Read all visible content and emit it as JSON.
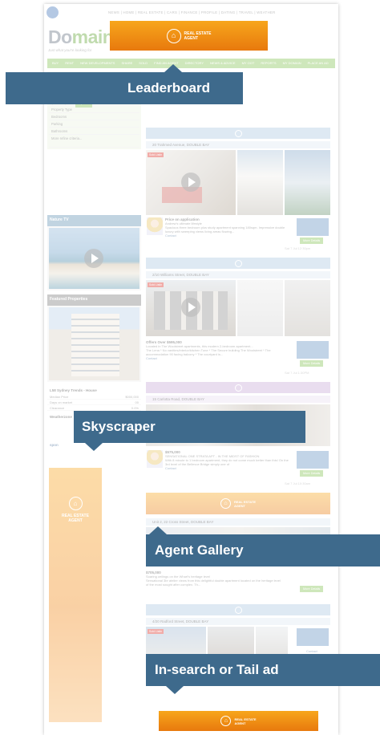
{
  "site": {
    "logo_text_a": "Do",
    "logo_text_b": "main",
    "tagline": "Just what you're looking for",
    "top_links": "NEWS | HOME | REAL ESTATE | CARS | FINANCE | PROFILE | DATING | TRAVEL | WEATHER",
    "nav": [
      "BUY",
      "RENT",
      "NEW DEVELOPMENTS",
      "SHARE",
      "SOLD",
      "FIND AN AGENT",
      "DIRECTORY",
      "NEWS & ADVICE",
      "MY OOT",
      "REPORTS",
      "MY DOMAIN",
      "PLACE AN AD"
    ]
  },
  "ads": {
    "brand_line1": "REAL ESTATE",
    "brand_line2": "AGENT"
  },
  "sidebar": {
    "rows": [
      "New developments",
      "Surrounding Suburbs",
      "Price",
      "$ Min   to $ Max",
      "Property Type",
      "Bedrooms",
      "Parking",
      "Bathrooms",
      "More refine criteria..."
    ],
    "update_btn": "Update",
    "widget1_title": "Nature TV",
    "widget2_title": "Featured Properties",
    "stats_title": "L58 Sydney Trends - House",
    "stats_rows": [
      {
        "k": "Median Price",
        "v": "$000,000"
      },
      {
        "k": "Days on market",
        "v": "00"
      },
      {
        "k": "Clearance",
        "v": "0.0%"
      }
    ],
    "weather_label": "Weatherzone",
    "spon_label": "spon"
  },
  "listings": [
    {
      "title": "20 Trahmed Avenue, DOUBLE BAY",
      "tag": "Sold Listin",
      "desc_title": "Price on application",
      "desc_sub": "Andrew's ultimate lifestyle",
      "desc_text": "Spacious three bedroom plus study apartment spanning 180sqm. Impressive double luxury with sweeping views living areas flowing...",
      "contact": "Contact",
      "more": "More Details",
      "inspect": "Sat 7 Jul 12:30pm"
    },
    {
      "title": "2/10 Williams Street, DOUBLE BAY",
      "tag": "Sold Listin",
      "desc_title": "Offers Over $595,000",
      "desc_sub": "Located in The Woolstreet apartments, this modern 2-bedroom apartment...",
      "desc_text": "The Lena * No vanities/interior/kitchen Tune * The Secure building The Woolstreet * The accommodation 90 facing balcony * The courtyard is...",
      "contact": "Contact",
      "more": "More Details",
      "inspect": "Sat 7 Jul 1:30PM"
    },
    {
      "title": "15 Carlotta Road, DOUBLE BAY",
      "tag": "",
      "desc_title": "$575,000",
      "desc_sub": "SENSATIONAL ONE STRATA APT - IN THE MIDST OF FASHION",
      "desc_text": "With 8 minute to 1 bedroom apartment, they do not come much better than this! On the 3rd level of the Bellevue Bridge simply one of",
      "contact": "Contact",
      "more": "More Details",
      "inspect": "Sat 7 Jul 10:30am"
    },
    {
      "title": "Unit 2, 22 Cross Street, DOUBLE BAY",
      "tag": "",
      "desc_title": "$705,000",
      "desc_sub": "Soaring ceilings on the Wharf's heritage level",
      "desc_text": "Sensational 3br atelier views from this delightful double apartment located on the heritage level of the most sought after complex. Th...",
      "contact": "",
      "more": "More Details",
      "inspect": ""
    },
    {
      "title": "4/20 Radford Street, DOUBLE BAY",
      "tag": "Sold Listin",
      "desc_title": "",
      "desc_sub": "",
      "desc_text": "",
      "contact": "Contact",
      "more": "More Details",
      "inspect": ""
    }
  ],
  "callouts": {
    "leaderboard": "Leaderboard",
    "skyscraper": "Skyscraper",
    "agent_gallery": "Agent Gallery",
    "tail": "In-search or Tail ad"
  }
}
